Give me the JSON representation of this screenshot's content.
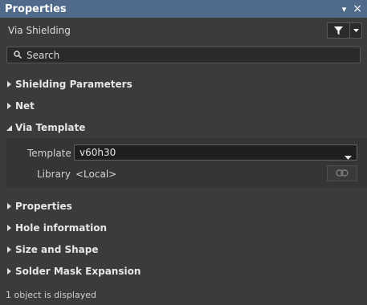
{
  "window": {
    "title": "Properties",
    "pin_glyph": "▾",
    "close_glyph": "×"
  },
  "object_type": "Via Shielding",
  "search": {
    "placeholder": "Search",
    "value": ""
  },
  "sections": [
    {
      "label": "Shielding Parameters",
      "expanded": false
    },
    {
      "label": "Net",
      "expanded": false
    },
    {
      "label": "Via Template",
      "expanded": true
    },
    {
      "label": "Properties",
      "expanded": false
    },
    {
      "label": "Hole information",
      "expanded": false
    },
    {
      "label": "Size and Shape",
      "expanded": false
    },
    {
      "label": "Solder Mask Expansion",
      "expanded": false
    }
  ],
  "via_template": {
    "template_label": "Template",
    "template_value": "v60h30",
    "library_label": "Library",
    "library_value": "<Local>"
  },
  "status_text": "1 object is displayed",
  "icons": {
    "filter": "funnel-icon",
    "dropdown": "chevron-down-icon",
    "search": "magnifier-icon",
    "link": "link-icon"
  },
  "colors": {
    "titlebar": "#4f6a8a",
    "background": "#3b3b3b",
    "panel": "#353535"
  }
}
